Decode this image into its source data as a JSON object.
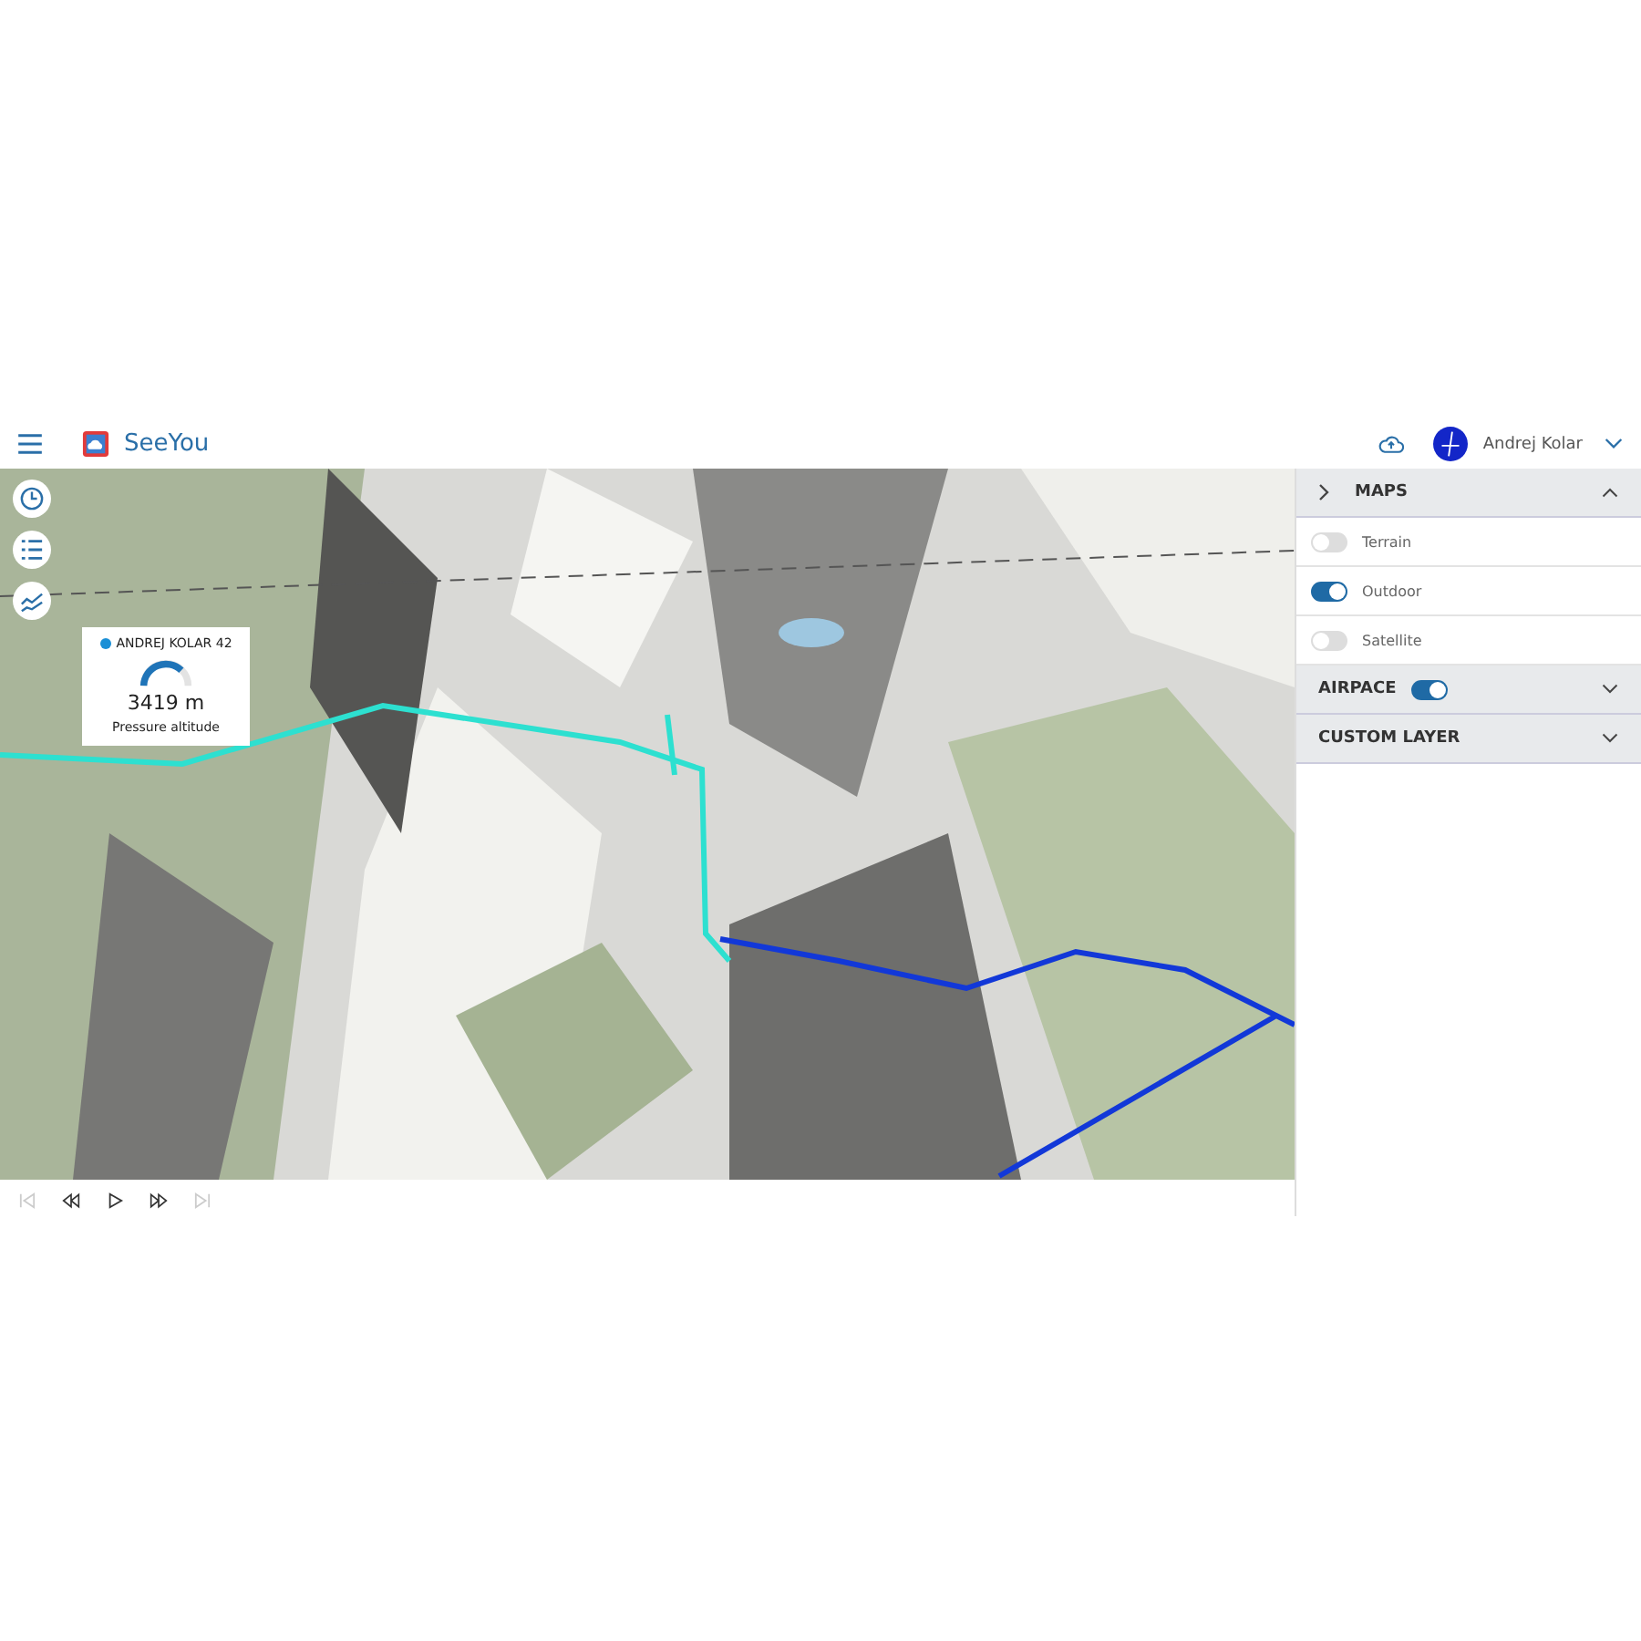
{
  "header": {
    "app_name": "SeeYou",
    "user_name": "Andrej Kolar"
  },
  "map_tools": [
    {
      "kind": "clock"
    },
    {
      "kind": "list"
    },
    {
      "kind": "chart"
    }
  ],
  "pilot_popup": {
    "pilot": "ANDREJ KOLAR 42",
    "color": "#1a8fd6",
    "value": "3419 m",
    "label": "Pressure altitude"
  },
  "tracks": [
    {
      "color": "#2de0d0"
    },
    {
      "color": "#1238d8"
    }
  ],
  "playback": [
    {
      "kind": "first",
      "disabled": true
    },
    {
      "kind": "rewind",
      "disabled": false
    },
    {
      "kind": "play",
      "disabled": false
    },
    {
      "kind": "forward",
      "disabled": false
    },
    {
      "kind": "last",
      "disabled": true
    }
  ],
  "panel": {
    "sections": [
      {
        "title": "MAPS",
        "expanded": true,
        "items": [
          {
            "label": "Terrain",
            "on": false
          },
          {
            "label": "Outdoor",
            "on": true
          },
          {
            "label": "Satellite",
            "on": false
          }
        ]
      },
      {
        "title": "AIRPACE",
        "expanded": false,
        "toggle": true
      },
      {
        "title": "CUSTOM LAYER",
        "expanded": false
      }
    ]
  }
}
